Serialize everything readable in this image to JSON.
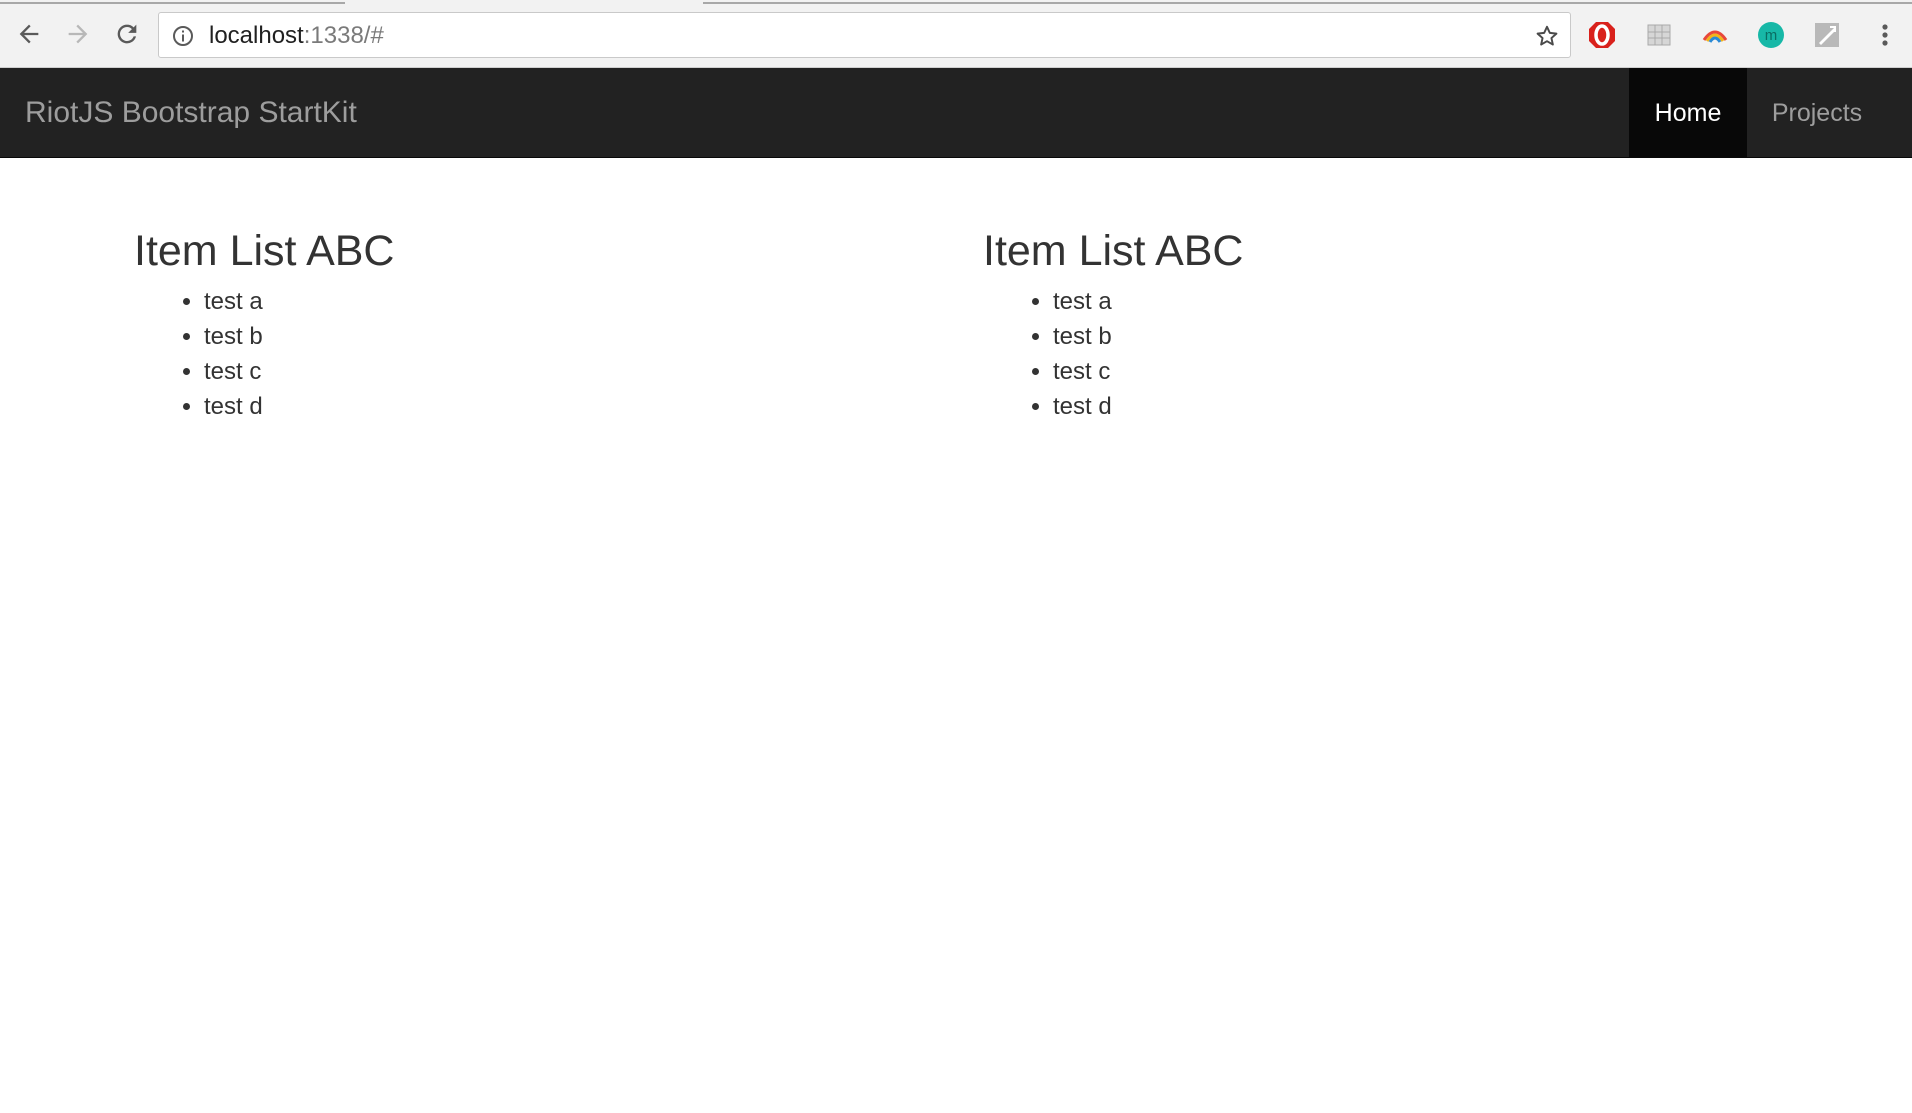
{
  "browser": {
    "url_host": "localhost",
    "url_rest": ":1338/#",
    "icons": {
      "back": "arrow-left-icon",
      "forward": "arrow-right-icon",
      "reload": "reload-icon",
      "info": "info-icon",
      "bookmark": "star-icon",
      "extensions": [
        "opera-adblock-icon",
        "grid-extension-icon",
        "rainbow-extension-icon",
        "m-extension-icon",
        "tool-extension-icon"
      ],
      "menu": "kebab-menu-icon"
    },
    "extension_m_letter": "m",
    "colors": {
      "chrome_bg": "#f2f2f2",
      "extension_m": "#17b8a7",
      "opera_red": "#d9211c"
    }
  },
  "navbar": {
    "brand": "RiotJS Bootstrap StartKit",
    "items": [
      {
        "label": "Home",
        "active": true
      },
      {
        "label": "Projects",
        "active": false
      }
    ],
    "colors": {
      "background": "#222222",
      "active_background": "#080808",
      "text": "#9d9d9d",
      "active_text": "#ffffff"
    }
  },
  "lists": [
    {
      "title": "Item List ABC",
      "items": [
        "test a",
        "test b",
        "test c",
        "test d"
      ]
    },
    {
      "title": "Item List ABC",
      "items": [
        "test a",
        "test b",
        "test c",
        "test d"
      ]
    }
  ]
}
